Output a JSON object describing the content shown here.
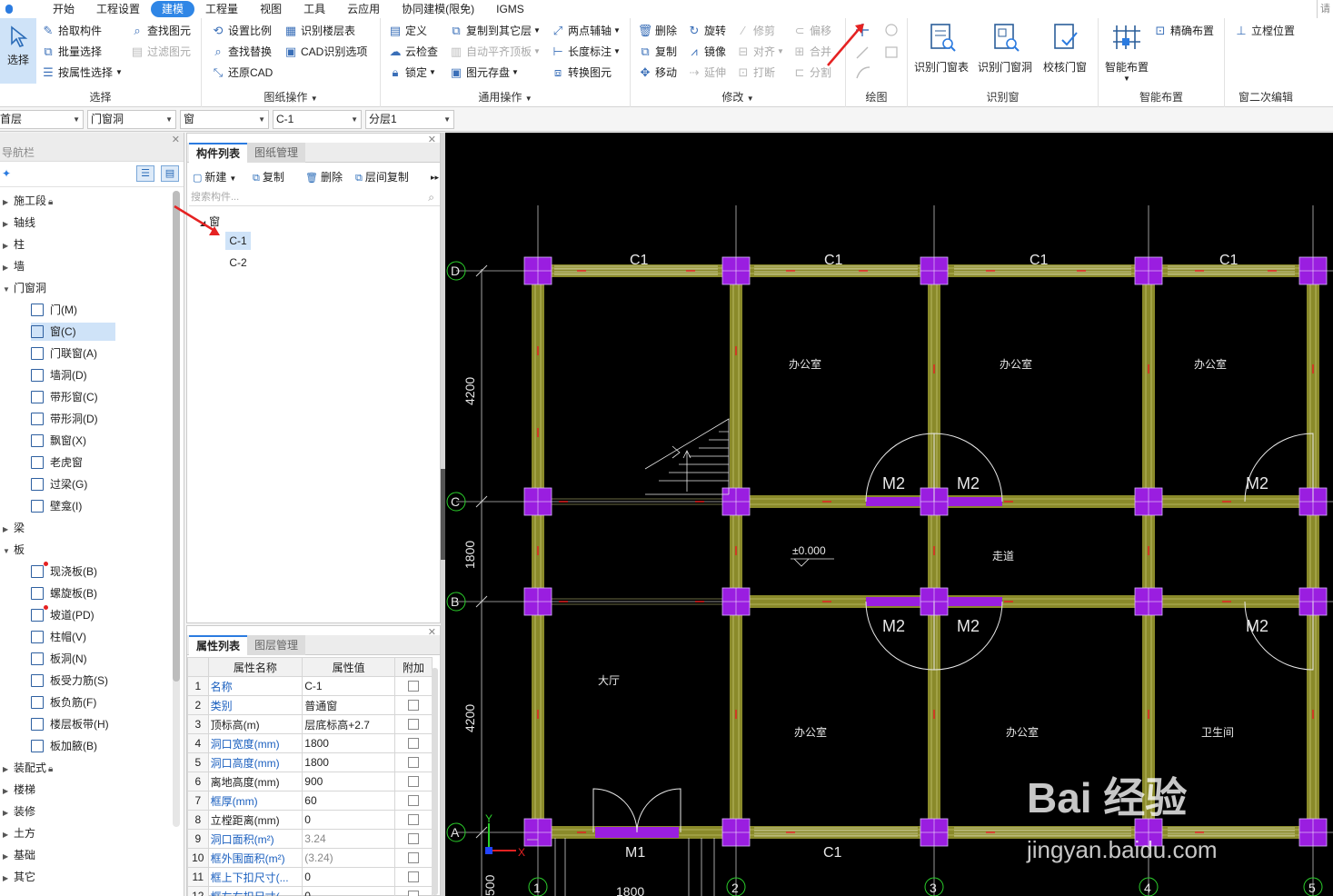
{
  "menu": {
    "items": [
      "开始",
      "工程设置",
      "建模",
      "工程量",
      "视图",
      "工具",
      "云应用",
      "协同建模(限免)",
      "IGMS"
    ],
    "active_index": 2,
    "right_hint": "请"
  },
  "ribbon": {
    "select": {
      "label": "选择",
      "pick": "拾取构件",
      "batch": "批量选择",
      "by_attr": "按属性选择",
      "find_elem": "查找图元",
      "filter_elem": "过滤图元",
      "group_title": "选择"
    },
    "drawing": {
      "set_scale": "设置比例",
      "recognize_floor_table": "识别楼层表",
      "find_replace": "查找替换",
      "cad_options": "CAD识别选项",
      "restore_cad": "还原CAD",
      "group_title": "图纸操作"
    },
    "general": {
      "define": "定义",
      "copy_to_floor": "复制到其它层",
      "two_point_axis": "两点辅轴",
      "cloud_check": "云检查",
      "auto_align_slab": "自动平齐顶板",
      "length_dim": "长度标注",
      "lock": "锁定",
      "elem_save": "图元存盘",
      "convert_elem": "转换图元",
      "group_title": "通用操作"
    },
    "modify": {
      "delete": "删除",
      "rotate": "旋转",
      "trim": "修剪",
      "offset": "偏移",
      "copy": "复制",
      "mirror": "镜像",
      "align": "对齐",
      "merge": "合并",
      "move": "移动",
      "extend": "延伸",
      "break": "打断",
      "split": "分割",
      "group_title": "修改"
    },
    "draw": {
      "group_title": "绘图"
    },
    "recognize_window": {
      "table": "识别门窗表",
      "opening": "识别门窗洞",
      "check": "校核门窗",
      "group_title": "识别窗"
    },
    "smart": {
      "smart_place": "智能布置",
      "precise_place": "精确布置",
      "group_title": "智能布置"
    },
    "secondary": {
      "stand_pos": "立樘位置",
      "group_title": "窗二次编辑"
    }
  },
  "selectors": {
    "floor": "首层",
    "category": "门窗洞",
    "type": "窗",
    "component": "C-1",
    "layer": "分层1"
  },
  "nav": {
    "title": "导航栏",
    "tree": [
      {
        "label": "施工段",
        "lock": true,
        "expanded": false
      },
      {
        "label": "轴线",
        "expanded": false
      },
      {
        "label": "柱",
        "expanded": false
      },
      {
        "label": "墙",
        "expanded": false
      },
      {
        "label": "门窗洞",
        "expanded": true
      },
      {
        "label": "梁",
        "expanded": false
      },
      {
        "label": "板",
        "expanded": true
      },
      {
        "label": "装配式",
        "lock": true,
        "expanded": false
      },
      {
        "label": "楼梯",
        "expanded": false
      },
      {
        "label": "装修",
        "expanded": false
      },
      {
        "label": "土方",
        "expanded": false
      },
      {
        "label": "基础",
        "expanded": false
      },
      {
        "label": "其它",
        "expanded": false
      }
    ],
    "opening_children": [
      "门(M)",
      "窗(C)",
      "门联窗(A)",
      "墙洞(D)",
      "带形窗(C)",
      "带形洞(D)",
      "飘窗(X)",
      "老虎窗",
      "过梁(G)",
      "壁龛(I)"
    ],
    "slab_children": [
      "现浇板(B)",
      "螺旋板(B)",
      "坡道(PD)",
      "柱帽(V)",
      "板洞(N)",
      "板受力筋(S)",
      "板负筋(F)",
      "楼层板带(H)",
      "板加腋(B)"
    ],
    "selected_child": "窗(C)"
  },
  "component_panel": {
    "tab_list": "构件列表",
    "tab_drawing": "图纸管理",
    "tools": {
      "new": "新建",
      "copy": "复制",
      "delete": "删除",
      "floor_copy": "层间复制"
    },
    "search_placeholder": "搜索构件...",
    "group": "窗",
    "items": [
      "C-1",
      "C-2"
    ],
    "selected": "C-1"
  },
  "property_panel": {
    "tab_props": "属性列表",
    "tab_layers": "图层管理",
    "headers": [
      "",
      "属性名称",
      "属性值",
      "附加"
    ],
    "rows": [
      {
        "n": "1",
        "name": "名称",
        "value": "C-1",
        "blue": true
      },
      {
        "n": "2",
        "name": "类别",
        "value": "普通窗",
        "blue": true
      },
      {
        "n": "3",
        "name": "顶标高(m)",
        "value": "层底标高+2.7",
        "blue": false
      },
      {
        "n": "4",
        "name": "洞口宽度(mm)",
        "value": "1800",
        "blue": true
      },
      {
        "n": "5",
        "name": "洞口高度(mm)",
        "value": "1800",
        "blue": true
      },
      {
        "n": "6",
        "name": "离地高度(mm)",
        "value": "900",
        "blue": false
      },
      {
        "n": "7",
        "name": "框厚(mm)",
        "value": "60",
        "blue": true
      },
      {
        "n": "8",
        "name": "立樘距离(mm)",
        "value": "0",
        "blue": false
      },
      {
        "n": "9",
        "name": "洞口面积(m²)",
        "value": "3.24",
        "blue": true,
        "grey": true
      },
      {
        "n": "10",
        "name": "框外围面积(m²)",
        "value": "(3.24)",
        "blue": true,
        "grey": true
      },
      {
        "n": "11",
        "name": "框上下扣尺寸(...",
        "value": "0",
        "blue": true
      },
      {
        "n": "12",
        "name": "框左右扣尺寸(...",
        "value": "0",
        "blue": true
      }
    ]
  },
  "cad": {
    "axes_h": [
      "D",
      "C",
      "B",
      "A"
    ],
    "axes_v": [
      "1",
      "2",
      "3",
      "4",
      "5"
    ],
    "windows_top": [
      "C1",
      "C1",
      "C1",
      "C1"
    ],
    "window_bottom": "C1",
    "door_main": "M1",
    "doors_m2": [
      "M2",
      "M2",
      "M2",
      "M2",
      "M2",
      "M2"
    ],
    "rooms": [
      "办公室",
      "办公室",
      "办公室",
      "走道",
      "大厅",
      "办公室",
      "办公室",
      "卫生间"
    ],
    "elevation": "±0.000",
    "dims": [
      "4200",
      "1800",
      "4200",
      "500",
      "1800"
    ],
    "watermark_top": "Bai 经验",
    "watermark_bottom": "jingyan.baidu.com",
    "colors": {
      "background": "#000000",
      "column": "#9a1ee0",
      "wall": "#8a8a2a",
      "opening": "#9a1ee0"
    }
  }
}
